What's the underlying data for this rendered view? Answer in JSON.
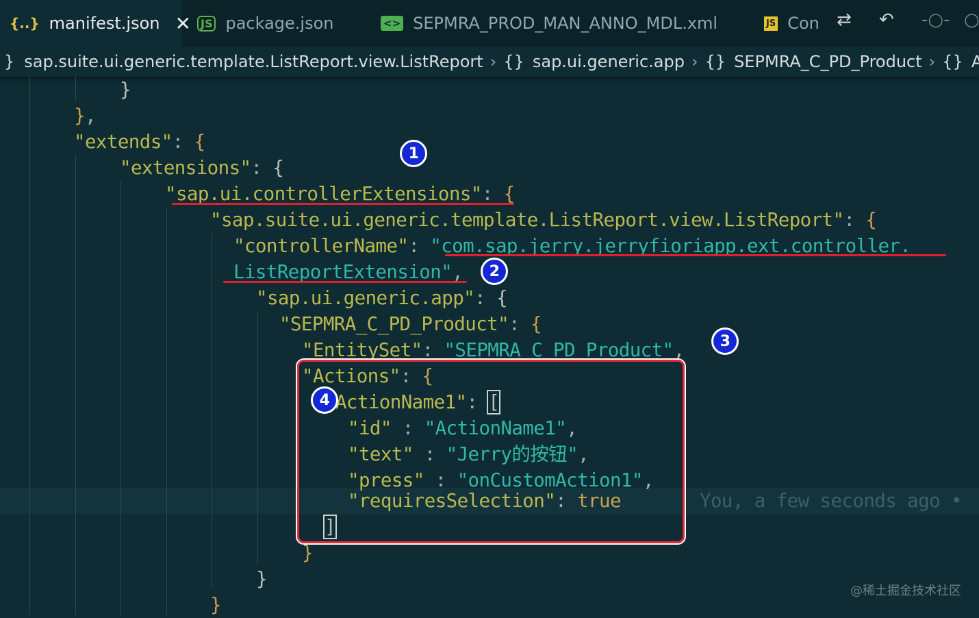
{
  "tabs": [
    {
      "icon": "{..}",
      "label": "manifest.json",
      "active": true,
      "close": "✕"
    },
    {
      "icon": "JS",
      "label": "package.json",
      "active": false
    },
    {
      "icon": "<>",
      "label": "SEPMRA_PROD_MAN_ANNO_MDL.xml",
      "active": false
    },
    {
      "icon": "JS",
      "label": "Con",
      "active": false
    }
  ],
  "toolbar_icons": [
    "source-control-compare-icon",
    "go-back-icon",
    "commit-dot-icon",
    "commit-dot-icon-2"
  ],
  "breadcrumb": {
    "lead_brace": "}",
    "items": [
      {
        "brace": "",
        "label": "sap.suite.ui.generic.template.ListReport.view.ListReport"
      },
      {
        "brace": "{}",
        "label": "sap.ui.generic.app"
      },
      {
        "brace": "{}",
        "label": "SEPMRA_C_PD_Product"
      },
      {
        "brace": "{}",
        "label": "Actions"
      }
    ]
  },
  "code": {
    "l01": "}",
    "l02a": "}",
    "l02b": ",",
    "l03k": "\"extends\"",
    "l03p": ": ",
    "l03b": "{",
    "l04k": "\"extensions\"",
    "l04p": ": ",
    "l04b": "{",
    "l05k": "\"sap.ui.controllerExtensions\"",
    "l05p": ": ",
    "l05b": "{",
    "l06k": "\"sap.suite.ui.generic.template.ListReport.view.ListReport\"",
    "l06p": ": ",
    "l06b": "{",
    "l07k": "\"controllerName\"",
    "l07p": ": ",
    "l07s": "\"com.sap.jerry.jerryfioriapp.ext.controller.",
    "l08s": "ListReportExtension\"",
    "l08p": ",",
    "l09k": "\"sap.ui.generic.app\"",
    "l09p": ": ",
    "l09b": "{",
    "l10k": "\"SEPMRA_C_PD_Product\"",
    "l10p": ": ",
    "l10b": "{",
    "l11k": "\"EntitySet\"",
    "l11p": ": ",
    "l11s": "\"SEPMRA_C_PD_Product\"",
    "l11c": ",",
    "l12k": "\"Actions\"",
    "l12p": ": ",
    "l12b": "{",
    "l13k": "\"ActionName1\"",
    "l13p": ": ",
    "l13b": "[",
    "l14k": "\"id\"",
    "l14p": " : ",
    "l14s": "\"ActionName1\"",
    "l14c": ",",
    "l15k": "\"text\"",
    "l15p": " : ",
    "l15s": "\"Jerry的按钮\"",
    "l15c": ",",
    "l16k": "\"press\"",
    "l16p": " : ",
    "l16s": "\"onCustomAction1\"",
    "l16c": ",",
    "l17k": "\"requiresSelection\"",
    "l17p": ": ",
    "l17v": "true",
    "l18": "]",
    "l19": "}",
    "l20": "}",
    "l21": "}"
  },
  "blame": "You, a few seconds ago •",
  "badges": [
    "1",
    "2",
    "3",
    "4"
  ],
  "watermark": "@稀土掘金技术社区",
  "colors": {
    "key": "#b9b94f",
    "string": "#2fb8a8",
    "brace": "#c9a04b",
    "annotation_red": "#e0202c",
    "badge_blue": "#1428d8"
  }
}
